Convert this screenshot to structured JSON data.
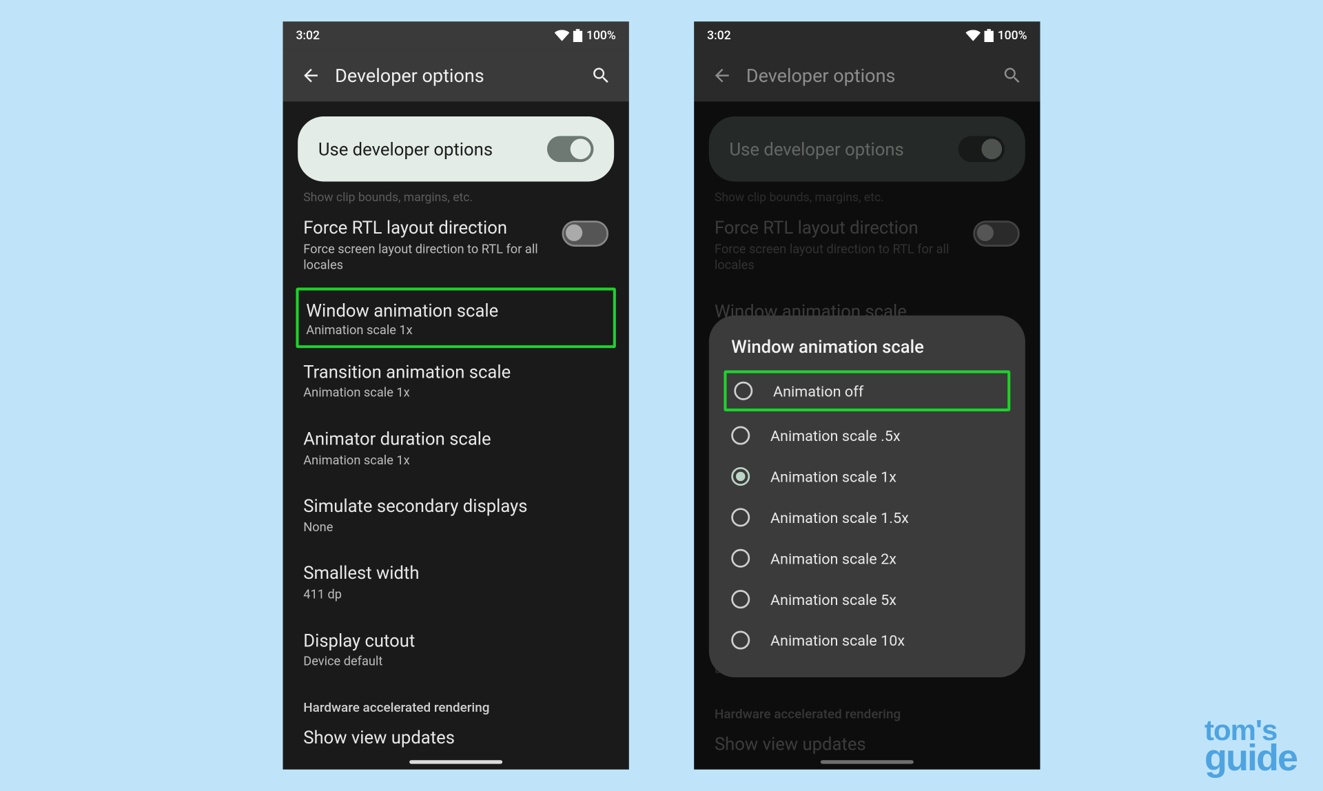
{
  "status": {
    "time": "3:02",
    "battery": "100%"
  },
  "appbar": {
    "title": "Developer options"
  },
  "card": {
    "label": "Use developer options"
  },
  "cutoff": "Show clip bounds, margins, etc.",
  "settings": {
    "rtl": {
      "title": "Force RTL layout direction",
      "sub": "Force screen layout direction to RTL for all locales"
    },
    "winAnim": {
      "title": "Window animation scale",
      "sub": "Animation scale 1x"
    },
    "transAnim": {
      "title": "Transition animation scale",
      "sub": "Animation scale 1x"
    },
    "animDur": {
      "title": "Animator duration scale",
      "sub": "Animation scale 1x"
    },
    "simDisp": {
      "title": "Simulate secondary displays",
      "sub": "None"
    },
    "smWidth": {
      "title": "Smallest width",
      "sub": "411 dp"
    },
    "dispCut": {
      "title": "Display cutout",
      "sub": "Device default"
    }
  },
  "sectionHeader": "Hardware accelerated rendering",
  "bottomCut": "Show view updates",
  "dialog": {
    "title": "Window animation scale",
    "options": [
      "Animation off",
      "Animation scale .5x",
      "Animation scale 1x",
      "Animation scale 1.5x",
      "Animation scale 2x",
      "Animation scale 5x",
      "Animation scale 10x"
    ],
    "selectedIndex": 2,
    "highlightIndex": 0
  },
  "logo": {
    "line1": "tom's",
    "line2": "guide"
  }
}
